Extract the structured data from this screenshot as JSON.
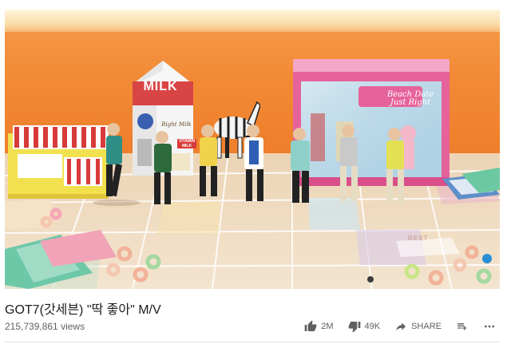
{
  "video": {
    "title": "GOT7(갓세븐) \"딱 좋아\" M/V",
    "view_count": "215,739,861 views",
    "scene_text": {
      "milk_carton": "MILK",
      "milk_sub": "Right Milk",
      "vitamin": "VITAMIN MILK",
      "box_line1": "Beach Date",
      "box_line2": "Just Right",
      "board_label": "REST"
    }
  },
  "actions": {
    "like_count": "2M",
    "dislike_count": "49K",
    "share_label": "SHARE"
  },
  "icons": {
    "like": "thumbs-up-icon",
    "dislike": "thumbs-down-icon",
    "share": "share-arrow-icon",
    "save": "add-to-playlist-icon",
    "more": "more-dots-icon"
  },
  "colors": {
    "wall": "#f28a35",
    "box_pink": "#e6629a",
    "text_primary": "#1c1c1c",
    "text_secondary": "#606060"
  }
}
